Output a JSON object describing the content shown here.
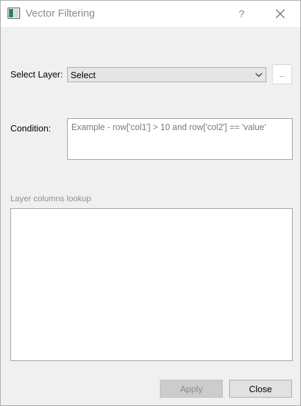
{
  "window": {
    "title": "Vector Filtering",
    "help_label": "?"
  },
  "form": {
    "select_layer_label": "Select Layer:",
    "layer_combo_value": "Select",
    "browse_label": "...",
    "condition_label": "Condition:",
    "condition_placeholder": "Example - row['col1'] > 10 and row['col2'] == 'value'",
    "condition_value": "",
    "lookup_label": "Layer columns lookup"
  },
  "buttons": {
    "apply_label": "Apply",
    "close_label": "Close"
  },
  "icons": {
    "app": "app-window-icon",
    "close": "close-icon",
    "dropdown": "chevron-down-icon"
  }
}
